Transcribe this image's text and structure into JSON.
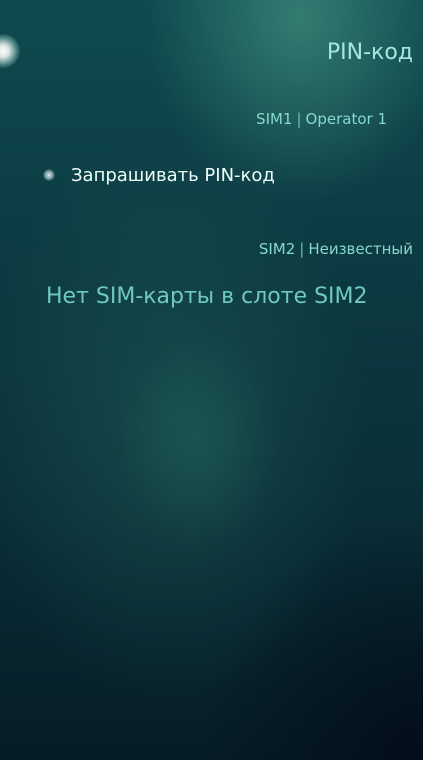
{
  "page": {
    "title": "PIN-код"
  },
  "sim1": {
    "header_sim": "SIM1",
    "header_operator": "Operator 1",
    "separator": "|",
    "switch_label": "Запрашивать PIN-код",
    "switch_checked": false
  },
  "sim2": {
    "header_sim": "SIM2",
    "header_operator": "Неизвестный",
    "separator": "|",
    "placeholder": "Нет SIM-карты в слоте SIM2"
  },
  "icons": {
    "pulley": "pulley-menu-glow-icon",
    "switch": "switch-indicator-icon"
  },
  "colors": {
    "accent": "#86d8cc",
    "primary_text": "#eefcfa",
    "background_top": "#0f4a4f",
    "background_bottom": "#061c26"
  }
}
